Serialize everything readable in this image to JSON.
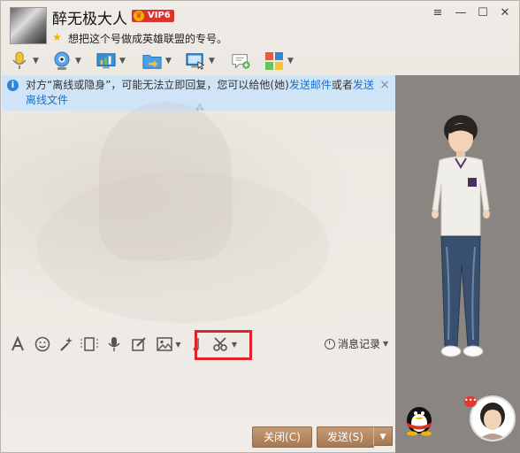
{
  "header": {
    "contact_name": "醉无极大人",
    "vip_label": "VIP6",
    "signature": "想把这个号做成英雄联盟的专号。"
  },
  "window_controls": {
    "menu": "≡",
    "minimize": "—",
    "maximize": "☐",
    "close": "✕"
  },
  "toolbar": {
    "items": [
      {
        "name": "voice-call",
        "icon": "microphone-icon"
      },
      {
        "name": "video-call",
        "icon": "webcam-icon"
      },
      {
        "name": "remote-desktop",
        "icon": "monitor-chart-icon"
      },
      {
        "name": "send-file",
        "icon": "folder-arrow-icon"
      },
      {
        "name": "share-screen",
        "icon": "screen-share-icon"
      },
      {
        "name": "create-discussion",
        "icon": "chat-add-icon"
      },
      {
        "name": "apps",
        "icon": "app-grid-icon"
      }
    ]
  },
  "notice": {
    "text_before": "对方“离线或隐身”，可能无法立即回复，您可以给他(她)",
    "link_email": "发送邮件",
    "text_middle": "或者",
    "link_offline_file": "发送离线文件",
    "close": "×"
  },
  "format_bar": {
    "items": [
      "font-icon",
      "emoji-icon",
      "magic-icon",
      "frame-icon",
      "voice-message-icon",
      "edit-icon",
      "image-icon",
      "music-icon",
      "scissors-icon"
    ],
    "history_label": "消息记录"
  },
  "buttons": {
    "close_label": "关闭(C)",
    "send_label": "发送(S)"
  },
  "right_panel": {
    "bubble_text": "•••"
  },
  "colors": {
    "notice_bg": "#cfe5f7",
    "link": "#1d6fc9",
    "highlight": "#e0232a",
    "button": "#b98a63",
    "vip": "#d9342b"
  }
}
